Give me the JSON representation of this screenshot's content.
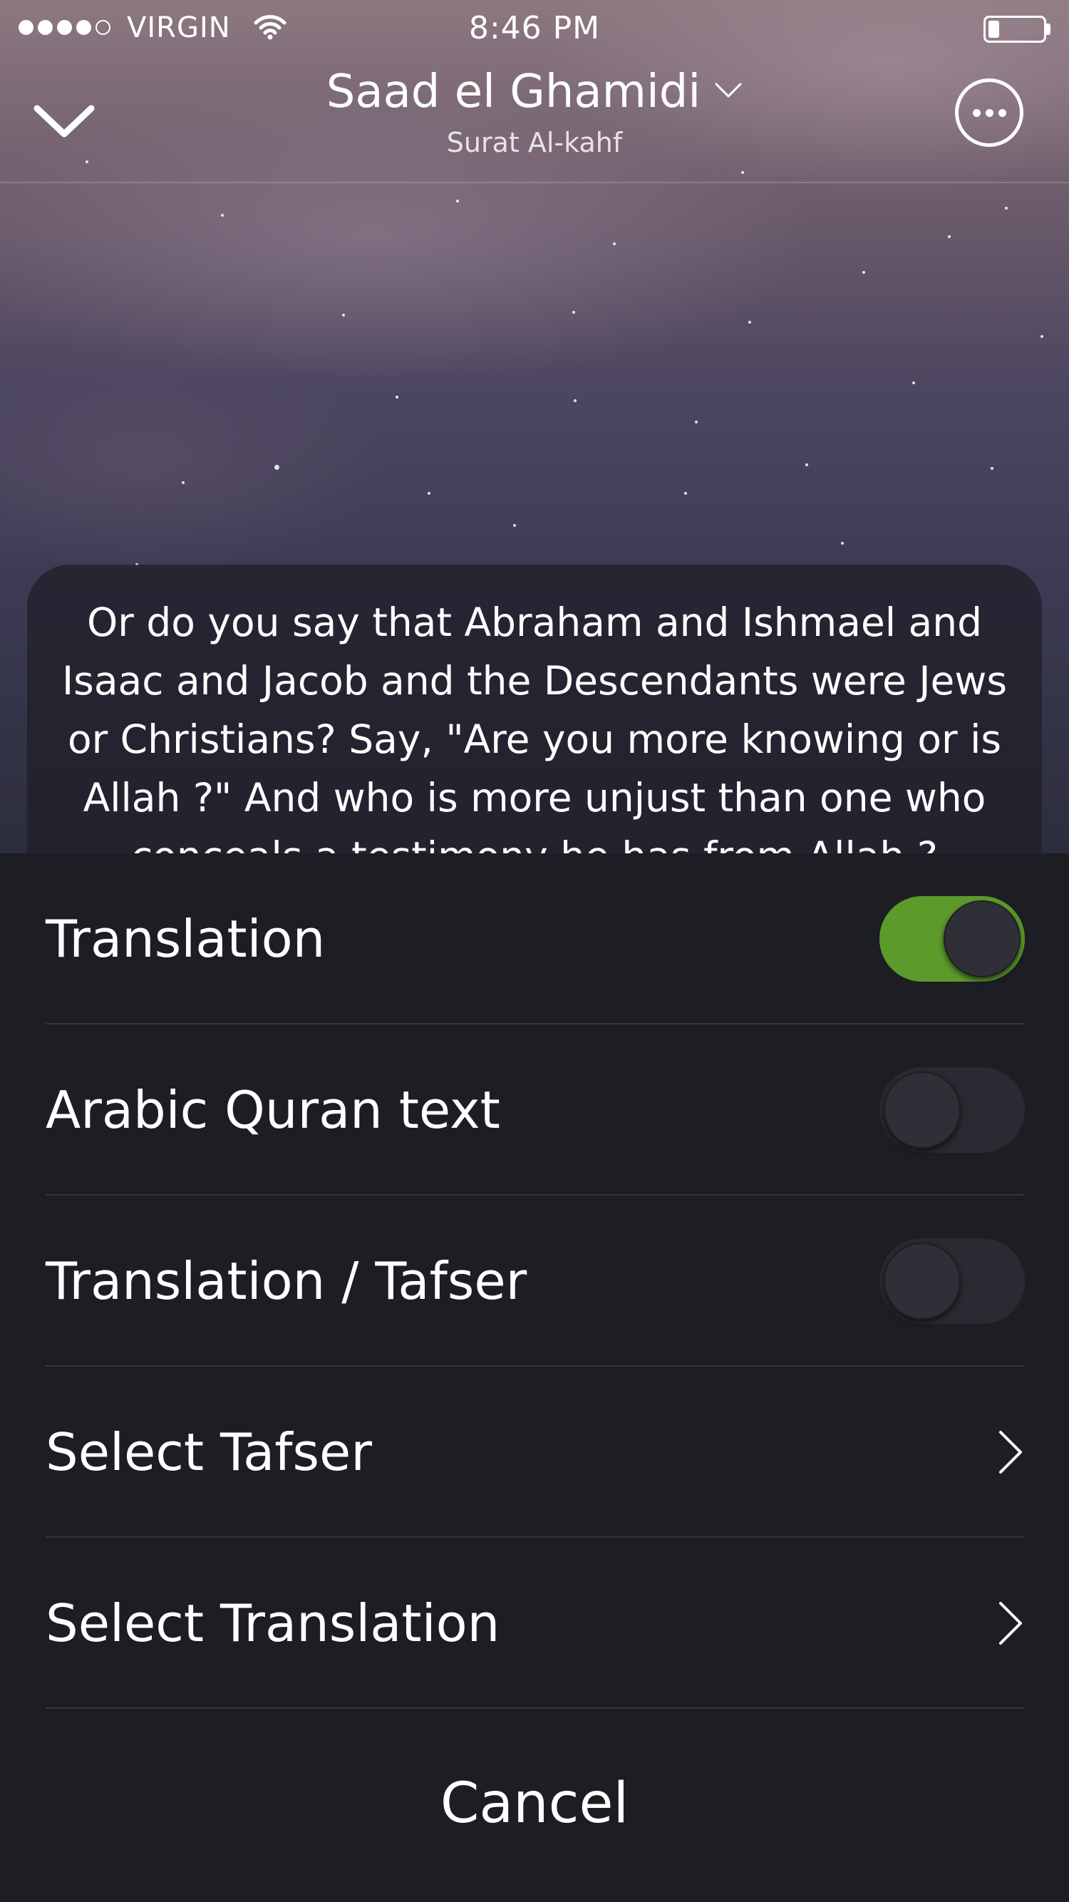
{
  "status_bar": {
    "carrier": "VIRGIN",
    "time": "8:46 PM",
    "signal_bars_filled": 4,
    "signal_bars_total": 5,
    "battery_level": 0.2
  },
  "header": {
    "reciter": "Saad el Ghamidi",
    "surah": "Surat Al-kahf",
    "collapse_icon": "chevron-down-icon",
    "more_icon": "more-options-icon"
  },
  "verse": {
    "text": "Or do you say that Abraham and Ishmael and Isaac and Jacob and the Descendants were Jews or Christians? Say, \"Are you more knowing or is Allah ?\" And who is more unjust than one who conceals a testimony he has from Allah ?"
  },
  "sheet": {
    "options": [
      {
        "label": "Translation",
        "type": "toggle",
        "on": true
      },
      {
        "label": "Arabic Quran text",
        "type": "toggle",
        "on": false
      },
      {
        "label": "Translation / Tafser",
        "type": "toggle",
        "on": false
      },
      {
        "label": "Select Tafser",
        "type": "link"
      },
      {
        "label": "Select Translation",
        "type": "link"
      }
    ],
    "cancel_label": "Cancel"
  },
  "colors": {
    "toggle_on": "#5d9a2c",
    "sheet_background": "#1d1e23",
    "divider": "#34353c"
  }
}
